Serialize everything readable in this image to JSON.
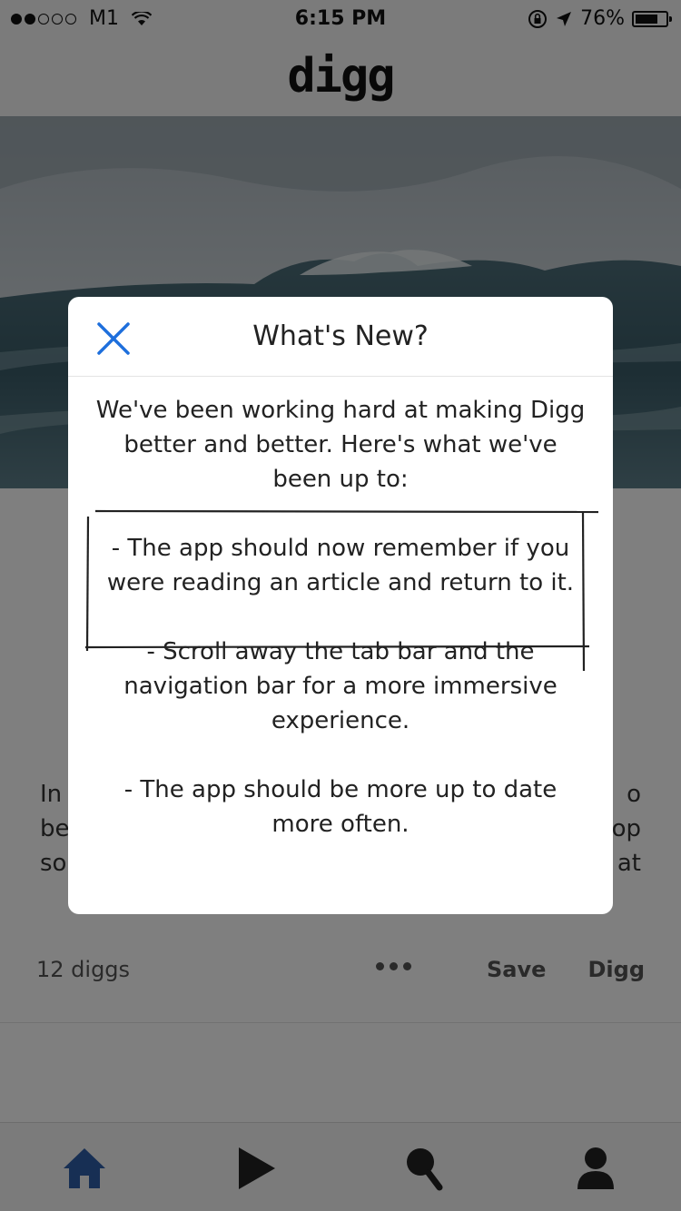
{
  "status_bar": {
    "carrier": "M1",
    "time": "6:15 PM",
    "battery": "76%",
    "battery_level": 0.76,
    "icons": [
      "signal-icon",
      "wifi-icon",
      "orientation-lock-icon",
      "location-arrow-icon",
      "battery-icon"
    ]
  },
  "nav": {
    "logo": "digg"
  },
  "article": {
    "excerpt_fragments": {
      "left_1": "In",
      "left_2": "be",
      "left_3": "so",
      "right_1": "o",
      "right_2": "op",
      "right_3": "at"
    },
    "digg_count": "12 diggs",
    "save_label": "Save",
    "digg_label": "Digg"
  },
  "modal": {
    "title": "What's New?",
    "intro": "We've been working hard at making Digg better and better. Here's what we've been up to:",
    "notes": [
      "- The app should now remember if you were reading an article and return to it.",
      "- Scroll away the tab bar and the navigation bar for a more immersive experience.",
      "- The app should be more up to date more often."
    ]
  },
  "tab_bar": {
    "tabs": [
      {
        "name": "home",
        "icon": "home-icon",
        "active": true
      },
      {
        "name": "video",
        "icon": "play-icon",
        "active": false
      },
      {
        "name": "search",
        "icon": "search-icon",
        "active": false
      },
      {
        "name": "profile",
        "icon": "profile-icon",
        "active": false
      }
    ]
  },
  "colors": {
    "accent": "#1e6fdc",
    "tab_active": "#2f5ea8",
    "overlay": "rgba(0,0,0,0.5)"
  }
}
